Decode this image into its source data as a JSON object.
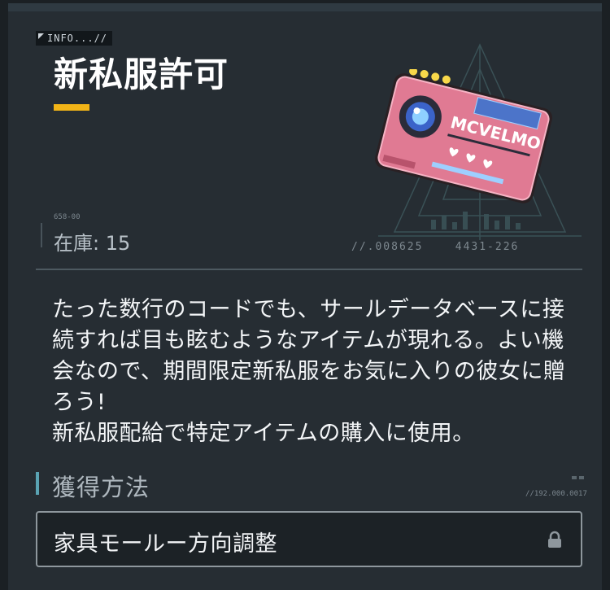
{
  "header": {
    "info_tag": "INFO...//"
  },
  "item": {
    "name": "新私服許可",
    "stock_code": "658-00",
    "stock_label": "在庫: 15",
    "serial": "//.008625    4431-226",
    "card_brand": "MCVELMO",
    "description": "たった数行のコードでも、サールデータベースに接続すれば目も眩むようなアイテムが現れる。よい機会なので、期間限定新私服をお気に入りの彼女に贈ろう!\n新私服配給で特定アイテムの購入に使用。"
  },
  "acquisition": {
    "title": "獲得方法",
    "code": "//192.000.0017",
    "sources": [
      {
        "label": "家具モールー方向調整",
        "locked": true,
        "icon": "lock-icon"
      }
    ]
  },
  "colors": {
    "accent": "#f2b417",
    "panel": "#262d33",
    "card": "#e07a93"
  }
}
